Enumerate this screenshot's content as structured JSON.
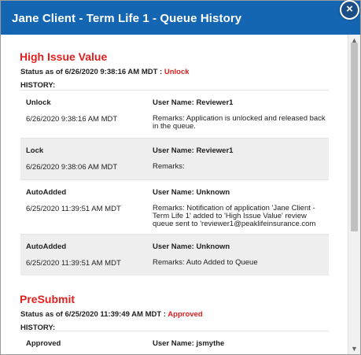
{
  "dialog": {
    "title": "Jane Client - Term Life 1 - Queue History",
    "close_icon": "×"
  },
  "sections": [
    {
      "title": "High Issue Value",
      "status_prefix": "Status as of 6/26/2020 9:38:16 AM MDT :",
      "status_value": "Unlock",
      "history_label": "HISTORY:",
      "entries": [
        {
          "action": "Unlock",
          "user": "User Name: Reviewer1",
          "date": "6/26/2020 9:38:16 AM MDT",
          "remarks": "Remarks: Application is unlocked and released back in the queue."
        },
        {
          "action": "Lock",
          "user": "User Name: Reviewer1",
          "date": "6/26/2020 9:38:06 AM MDT",
          "remarks": "Remarks:"
        },
        {
          "action": "AutoAdded",
          "user": "User Name: Unknown",
          "date": "6/25/2020 11:39:51 AM MDT",
          "remarks": "Remarks: Notification of application 'Jane Client - Term Life 1' added to 'High Issue Value' review queue sent to 'reviewer1@peaklifeinsurance.com"
        },
        {
          "action": "AutoAdded",
          "user": "User Name: Unknown",
          "date": "6/25/2020 11:39:51 AM MDT",
          "remarks": "Remarks: Auto Added to Queue"
        }
      ]
    },
    {
      "title": "PreSubmit",
      "status_prefix": "Status as of 6/25/2020 11:39:49 AM MDT :",
      "status_value": "Approved",
      "history_label": "HISTORY:",
      "entries": [
        {
          "action": "Approved",
          "user": "User Name: jsmythe"
        }
      ]
    }
  ],
  "colors": {
    "title_bar": "#1466b3",
    "section_title": "#e01f1f",
    "alt_row": "#eeeeee"
  },
  "icons": {
    "close": "close-icon",
    "scroll_up": "chevron-up-icon",
    "scroll_down": "chevron-down-icon"
  }
}
